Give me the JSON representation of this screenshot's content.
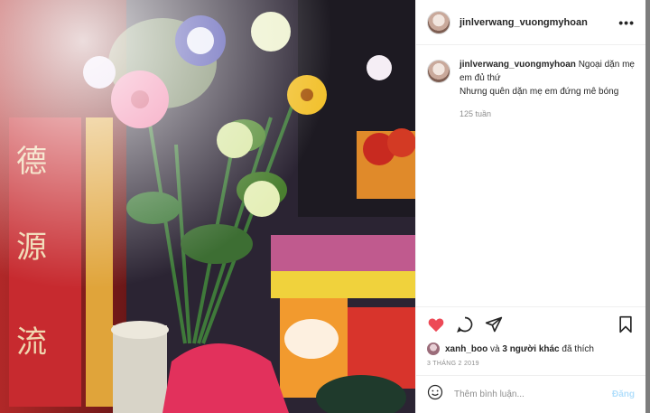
{
  "post": {
    "username": "jinlverwang_vuongmyhoan",
    "more_icon": "more-horizontal-icon",
    "photo": "photo-of-flowers-on-altar"
  },
  "caption": {
    "username": "jinlverwang_vuongmyhoan",
    "line1": "Ngoại dặn mẹ em đủ thứ",
    "line2": "Nhưng quên dặn mẹ em đứng mê bóng",
    "time": "125 tuần"
  },
  "actions": {
    "like_icon": "heart-filled-icon",
    "comment_icon": "comment-icon",
    "share_icon": "share-icon",
    "save_icon": "bookmark-icon",
    "like_color": "#ed4956"
  },
  "likes": {
    "user": "xanh_boo",
    "connector": " và ",
    "others": "3 người khác",
    "suffix": " đã thích"
  },
  "date": "3 THÁNG 2 2019",
  "add_comment": {
    "placeholder": "Thêm bình luận...",
    "post_label": "Đăng",
    "emoji_icon": "emoji-icon"
  }
}
